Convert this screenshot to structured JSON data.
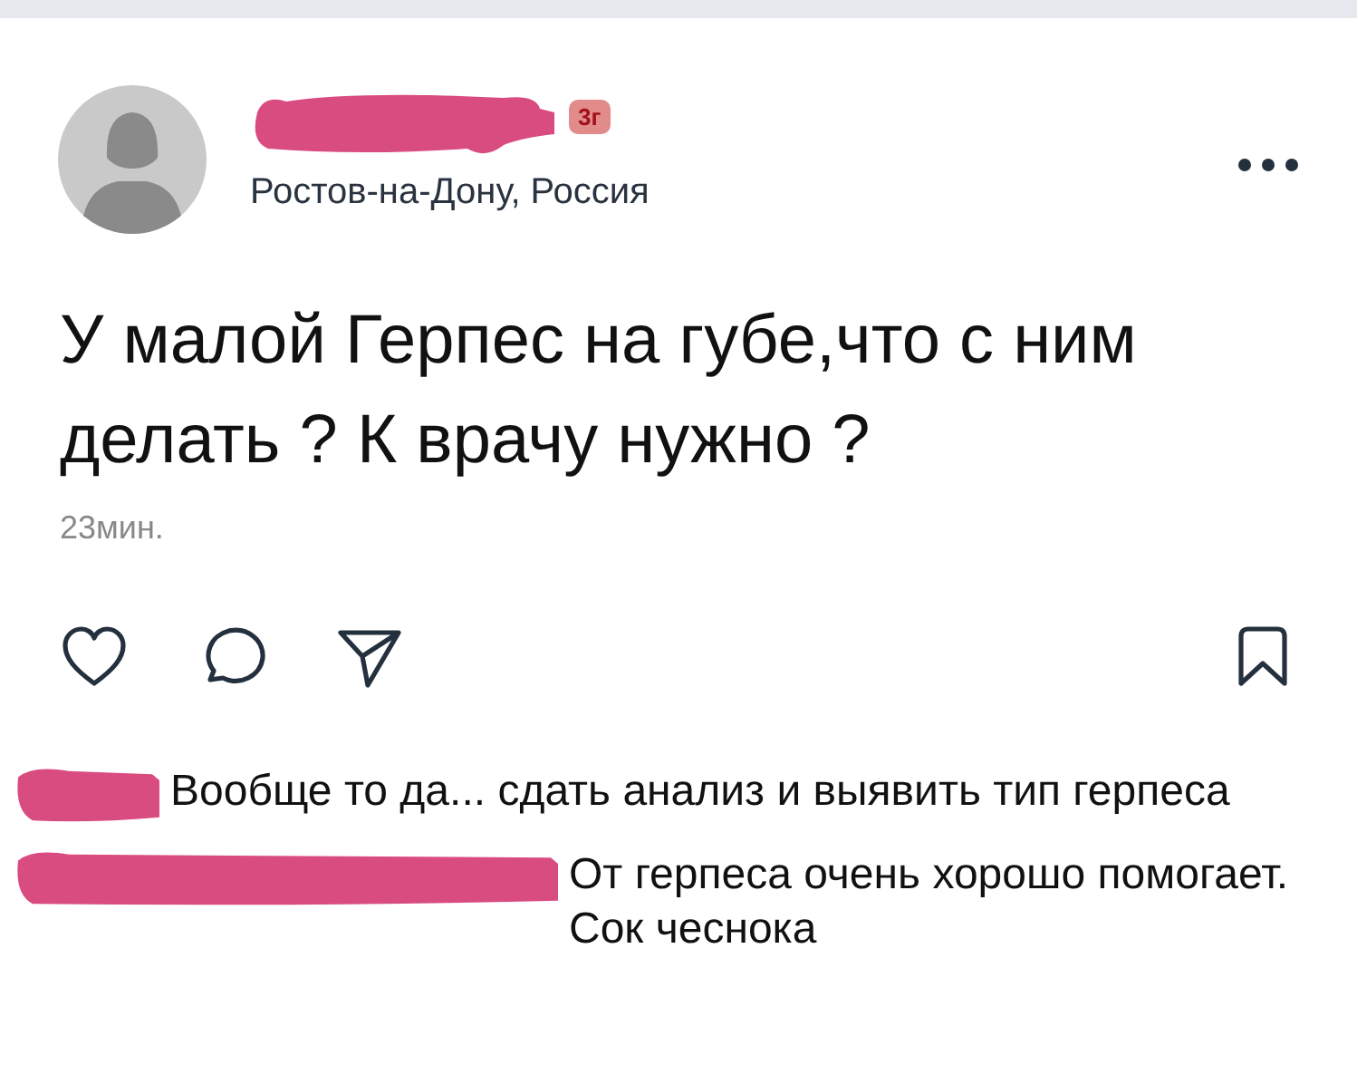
{
  "post": {
    "author": {
      "badge": "3г",
      "location": "Ростов-на-Дону, Россия"
    },
    "text": "У малой Герпес на губе,что с ним делать ? К врачу нужно ?",
    "time": "23мин."
  },
  "comments": [
    {
      "text": "Вообще то да... сдать анализ и выявить тип герпеса"
    },
    {
      "text": "От герпеса очень хорошо помогает. Сок чеснока"
    }
  ]
}
